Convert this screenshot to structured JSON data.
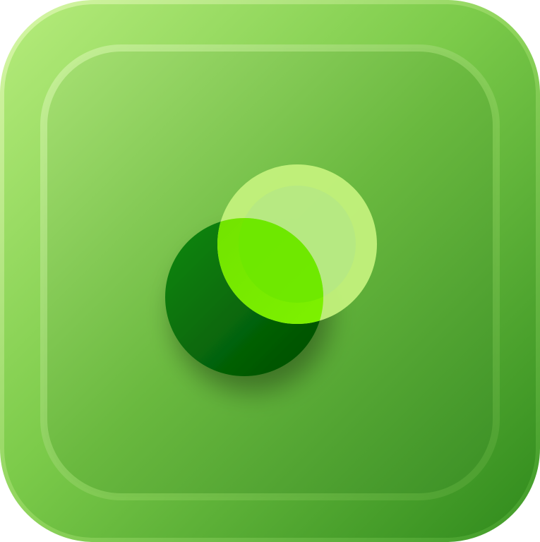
{
  "app_icon": {
    "icon_name": "overlapping-circles-app-icon",
    "colors": {
      "outer_light": "#b6ec7c",
      "outer_mid": "#78c946",
      "outer_dark": "#2f8a1c",
      "inner_light": "#a4e070",
      "inner_mid": "#6fbd42",
      "inner_dark": "#3c9226",
      "dark_circle_top": "#0e8a10",
      "dark_circle_bottom": "#004f00",
      "light_circle_ring": "#c3f17c",
      "light_circle_core": "#b5e884",
      "overlap_green": "#78f000"
    }
  }
}
